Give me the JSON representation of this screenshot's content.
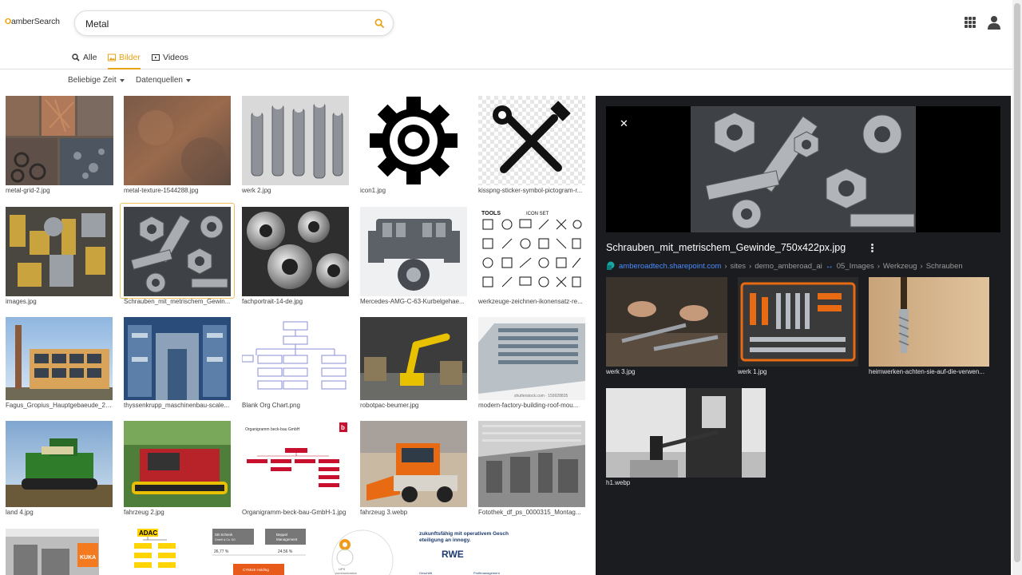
{
  "logo": {
    "o": "O",
    "text": "amberSearch"
  },
  "search": {
    "value": "Metal",
    "placeholder": ""
  },
  "tabs": [
    {
      "label": "Alle",
      "icon": "search-icon"
    },
    {
      "label": "Bilder",
      "icon": "image-icon",
      "active": true
    },
    {
      "label": "Videos",
      "icon": "video-icon"
    }
  ],
  "filters": {
    "time": "Beliebige Zeit",
    "sources": "Datenquellen"
  },
  "results": [
    {
      "caption": "metal-grid-2.jpg"
    },
    {
      "caption": "metal-texture-1544288.jpg"
    },
    {
      "caption": "werk 2.jpg"
    },
    {
      "caption": "icon1.jpg"
    },
    {
      "caption": "kisspng-sticker-symbol-pictogram-r..."
    },
    {
      "caption": "images.jpg"
    },
    {
      "caption": "Schrauben_mit_metrischem_Gewin..."
    },
    {
      "caption": "fachportrait-14-de.jpg"
    },
    {
      "caption": "Mercedes-AMG-C-63-Kurbelgehae..."
    },
    {
      "caption": "werkzeuge-zeichnen-ikonensatz-re..."
    },
    {
      "caption": "Fagus_Gropius_Hauptgebaeude_20..."
    },
    {
      "caption": "thyssenkrupp_maschinenbau-scale..."
    },
    {
      "caption": "Blank Org Chart.png"
    },
    {
      "caption": "robotpac-beumer.jpg"
    },
    {
      "caption": "modern-factory-building-roof-mou..."
    },
    {
      "caption": "land 4.jpg"
    },
    {
      "caption": "fahrzeug 2.jpg"
    },
    {
      "caption": "Organigramm-beck-bau-GmbH-1.jpg"
    },
    {
      "caption": "fahrzeug 3.webp"
    },
    {
      "caption": "Fotothek_df_ps_0000315_Montag..."
    },
    {
      "caption": ""
    },
    {
      "caption": ""
    },
    {
      "caption": ""
    },
    {
      "caption": ""
    },
    {
      "caption": ""
    }
  ],
  "image_text": {
    "tools_title": "TOOLS",
    "icon_set": "ICON SET",
    "factory_credit": "shutterstock.com · 159928835",
    "org_title": "Organigramm beck-bau GmbH",
    "org_logo": "b",
    "kuka": "KUKA",
    "adac": "ADAC",
    "sb_schenk": "SB Schenk",
    "sb_schenk_sub": "GmbH & Co. KG",
    "beppel": "Beppel",
    "beppel_sub": "Management",
    "pct1": "26,77 %",
    "pct2": "24,56 %",
    "holding": "CYMUS Holding",
    "zukunft_line1": "zukunftsfähig mit operativem Gesch",
    "zukunft_line2": "eteiligung an innogy.",
    "rwe": "RWE",
    "geschaeft": "Geschäft",
    "profit": "Profitmanagement",
    "circle_a": "UPS",
    "circle_b": "communication"
  },
  "panel": {
    "title": "Schrauben_mit_metrischem_Gewinde_750x422px.jpg",
    "host": "amberoadtech.sharepoint.com",
    "path": [
      "sites",
      "demo_amberoad_ai",
      "05_Images",
      "Werkzeug",
      "Schrauben"
    ],
    "related": [
      {
        "caption": "werk 3.jpg"
      },
      {
        "caption": "werk 1.jpg"
      },
      {
        "caption": "heimwerken-achten-sie-auf-die-verwen..."
      },
      {
        "caption": "h1.webp"
      }
    ]
  }
}
